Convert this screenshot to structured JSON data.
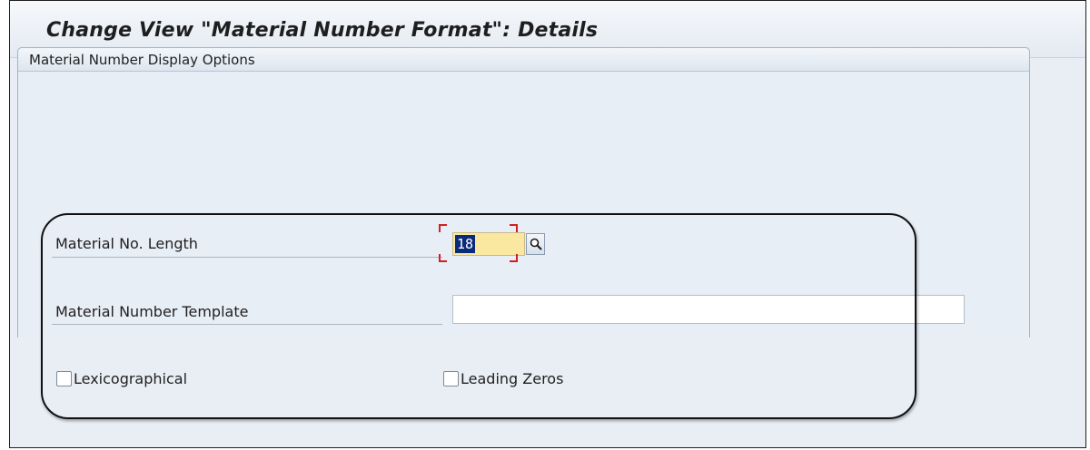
{
  "window": {
    "title": "Change View \"Material Number Format\": Details"
  },
  "toolbar": {
    "buttons": [
      {
        "name": "display-change-icon"
      },
      {
        "name": "undo-icon"
      },
      {
        "name": "previous-entry-icon"
      },
      {
        "name": "next-entry-icon"
      },
      {
        "name": "select-block-icon"
      }
    ]
  },
  "group": {
    "title": "Material Number Display Options"
  },
  "fields": {
    "length_label": "Material No. Length",
    "length_value": "18",
    "template_label": "Material Number Template",
    "template_value": "",
    "lexico_label": "Lexicographical",
    "leading_zeros_label": "Leading Zeros"
  },
  "colors": {
    "focus_field_bg": "#fbe8a0",
    "selection_bg": "#0a2a7a",
    "focus_marker": "#d21f1f",
    "screen_bg": "#e9eef5"
  }
}
